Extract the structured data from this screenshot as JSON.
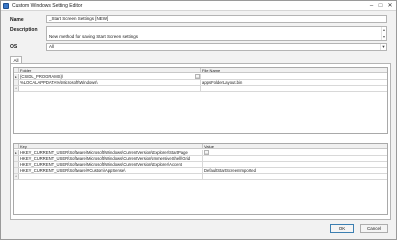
{
  "window": {
    "title": "Custom Windows Setting Editor"
  },
  "form": {
    "name_label": "Name",
    "name_value": "_Start Screen Settings [NEW]",
    "description_label": "Description",
    "description_value": "New method for saving Start Screen settings",
    "os_label": "OS",
    "os_value": "All"
  },
  "tabs": [
    {
      "label": "All"
    }
  ],
  "folders_grid": {
    "columns": [
      "Folder",
      "File Name"
    ],
    "rows": [
      {
        "marker": "▸",
        "folder": "{CSIDL_PROGRAMS}\\",
        "file": "",
        "ellipsis": "..."
      },
      {
        "marker": "",
        "folder": "%LOCALAPPDATA%\\Microsoft\\Windows\\",
        "file": "appsFolderLayout.bin",
        "ellipsis": ""
      },
      {
        "marker": "*",
        "folder": "",
        "file": "",
        "ellipsis": ""
      }
    ]
  },
  "registry_grid": {
    "columns": [
      "Key",
      "Value"
    ],
    "rows": [
      {
        "marker": "▸",
        "key": "HKEY_CURRENT_USER\\Software\\Microsoft\\Windows\\CurrentVersion\\Explorer\\StartPage",
        "value": "",
        "ellipsis": "..."
      },
      {
        "marker": "",
        "key": "HKEY_CURRENT_USER\\Software\\Microsoft\\Windows\\CurrentVersion\\ImmersiveShell\\Grid",
        "value": "",
        "ellipsis": ""
      },
      {
        "marker": "",
        "key": "HKEY_CURRENT_USER\\Software\\Microsoft\\Windows\\CurrentVersion\\Explorer\\Accent",
        "value": "",
        "ellipsis": ""
      },
      {
        "marker": "",
        "key": "HKEY_CURRENT_USER\\Software\\#Custom\\AppSense\\",
        "value": "DefaultStartScreenImported",
        "ellipsis": ""
      },
      {
        "marker": "*",
        "key": "",
        "value": "",
        "ellipsis": ""
      }
    ]
  },
  "buttons": {
    "ok": "OK",
    "cancel": "Cancel"
  },
  "icons": {
    "app": "settings-window-icon",
    "minimize": "minimize-icon",
    "maximize": "maximize-icon",
    "close": "close-icon"
  }
}
